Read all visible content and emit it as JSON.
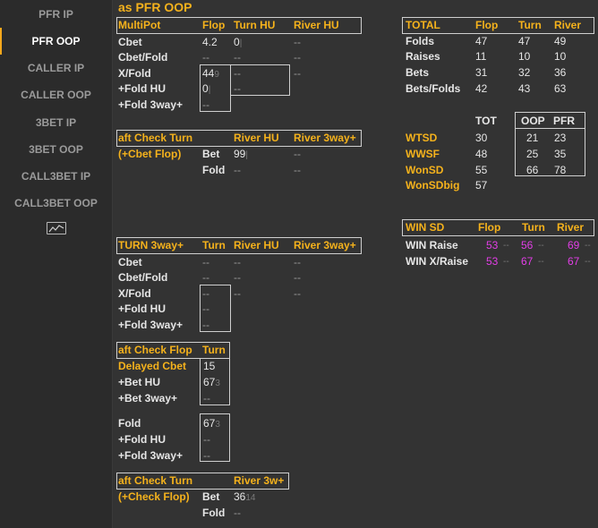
{
  "sidebar": {
    "items": [
      {
        "label": "PFR IP"
      },
      {
        "label": "PFR OOP",
        "active": true
      },
      {
        "label": "CALLER IP"
      },
      {
        "label": "CALLER OOP"
      },
      {
        "label": "3BET IP"
      },
      {
        "label": "3BET OOP"
      },
      {
        "label": "CALL3BET IP"
      },
      {
        "label": "CALL3BET OOP"
      }
    ],
    "chart_icon": "line-chart-icon"
  },
  "page_title": "as PFR OOP",
  "multipot": {
    "headers": [
      "MultiPot",
      "Flop",
      "Turn HU",
      "River HU"
    ],
    "rows": [
      {
        "label": "Cbet",
        "flop": "4.2",
        "flop_sub": "",
        "turn": "0",
        "turn_sub": "",
        "river": "--"
      },
      {
        "label": "Cbet/Fold",
        "flop": "--",
        "flop_sub": "",
        "turn": "--",
        "turn_sub": "",
        "river": "--"
      },
      {
        "label": "X/Fold",
        "flop": "44",
        "flop_sub": "9",
        "turn": "--",
        "turn_sub": "",
        "river": "--"
      },
      {
        "label": "+Fold HU",
        "flop": "0",
        "flop_sub": "",
        "turn": "--",
        "turn_sub": "",
        "river": ""
      },
      {
        "label": "+Fold 3way+",
        "flop": "--",
        "flop_sub": "",
        "turn": "",
        "turn_sub": "",
        "river": ""
      }
    ]
  },
  "aft_check_turn_1": {
    "headers": [
      "aft Check Turn",
      "River HU",
      "River 3way+"
    ],
    "sub": "(+Cbet Flop)",
    "rows": [
      {
        "label": "Bet",
        "hu": "99",
        "three": "--"
      },
      {
        "label": "Fold",
        "hu": "--",
        "three": "--"
      }
    ]
  },
  "turn_3way": {
    "headers": [
      "TURN 3way+",
      "Turn",
      "River HU",
      "River 3way+"
    ],
    "rows": [
      {
        "label": "Cbet",
        "turn": "--",
        "hu": "--",
        "three": "--"
      },
      {
        "label": "Cbet/Fold",
        "turn": "--",
        "hu": "--",
        "three": "--"
      },
      {
        "label": "X/Fold",
        "turn": "--",
        "hu": "--",
        "three": "--"
      },
      {
        "label": "+Fold HU",
        "turn": "--",
        "hu": "",
        "three": ""
      },
      {
        "label": "+Fold 3way+",
        "turn": "--",
        "hu": "",
        "three": ""
      }
    ]
  },
  "aft_check_flop": {
    "headers": [
      "aft Check Flop",
      "Turn"
    ],
    "rows": [
      {
        "label": "Delayed Cbet",
        "val": "15",
        "sub": "",
        "yellow": true
      },
      {
        "label": "+Bet HU",
        "val": "67",
        "sub": "3"
      },
      {
        "label": "+Bet 3way+",
        "val": "--",
        "sub": ""
      },
      {
        "label": "Fold",
        "val": "67",
        "sub": "3"
      },
      {
        "label": "+Fold HU",
        "val": "--",
        "sub": ""
      },
      {
        "label": "+Fold 3way+",
        "val": "--",
        "sub": ""
      }
    ]
  },
  "aft_check_turn_2": {
    "headers": [
      "aft Check Turn",
      "River 3w+"
    ],
    "sub": "(+Check Flop)",
    "rows": [
      {
        "label": "Bet",
        "val": "36",
        "sub": "14"
      },
      {
        "label": "Fold",
        "val": "--",
        "sub": ""
      }
    ]
  },
  "total": {
    "headers": [
      "TOTAL",
      "Flop",
      "Turn",
      "River"
    ],
    "rows": [
      {
        "label": "Folds",
        "flop": "47",
        "turn": "47",
        "river": "49"
      },
      {
        "label": "Raises",
        "flop": "11",
        "turn": "10",
        "river": "10"
      },
      {
        "label": "Bets",
        "flop": "31",
        "turn": "32",
        "river": "36"
      },
      {
        "label": "Bets/Folds",
        "flop": "42",
        "turn": "43",
        "river": "63"
      }
    ]
  },
  "showdown": {
    "headers": [
      "TOT",
      "OOP",
      "PFR"
    ],
    "rows": [
      {
        "label": "WTSD",
        "tot": "30",
        "oop": "21",
        "pfr": "23"
      },
      {
        "label": "WWSF",
        "tot": "48",
        "oop": "25",
        "pfr": "35"
      },
      {
        "label": "WonSD",
        "tot": "55",
        "oop": "66",
        "pfr": "78"
      },
      {
        "label": "WonSDbig",
        "tot": "57",
        "oop": "",
        "pfr": ""
      }
    ]
  },
  "win_sd": {
    "headers": [
      "WIN SD",
      "Flop",
      "Turn",
      "River"
    ],
    "rows": [
      {
        "label": "WIN Raise",
        "flop": "53",
        "turn": "56",
        "river": "69",
        "dash": "--"
      },
      {
        "label": "WIN X/Raise",
        "flop": "53",
        "turn": "67",
        "river": "67",
        "dash": "--"
      }
    ]
  }
}
